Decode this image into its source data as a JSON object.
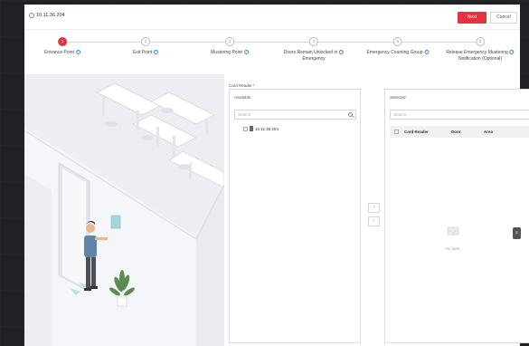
{
  "window": {
    "title": "10.11.36.204",
    "back_glyph": "‹"
  },
  "actions": {
    "next_label": "Next",
    "cancel_label": "Cancel"
  },
  "steps": [
    {
      "num": "1",
      "label": "Entrance Point",
      "active": true
    },
    {
      "num": "2",
      "label": "Exit Point",
      "active": false
    },
    {
      "num": "3",
      "label": "Mustering Point",
      "active": false
    },
    {
      "num": "4",
      "label": "Doors Remain Unlocked in",
      "label2": "Emergency",
      "active": false
    },
    {
      "num": "5",
      "label": "Emergency Counting Group",
      "active": false
    },
    {
      "num": "6",
      "label": "Release Emergency Mustering",
      "label2": "Notification (Optional)",
      "active": false
    }
  ],
  "step_info_glyph": "i",
  "card_reader": {
    "label": "Card Reader *",
    "available": {
      "title": "Available",
      "search_placeholder": "Search",
      "tree": [
        {
          "label": "10.11.36.204"
        }
      ]
    },
    "selected": {
      "title": "Selected",
      "search_placeholder": "Search",
      "columns": [
        "Card Reader",
        "Door",
        "Area"
      ],
      "empty_text": "No data."
    },
    "move_right": "›",
    "move_left": "‹"
  },
  "side_tab_glyph": "≡",
  "colors": {
    "accent": "#e7313b",
    "info": "#3a8ce6"
  },
  "icons": {
    "search": "search-icon",
    "back": "back-icon",
    "device": "device-icon",
    "empty": "empty-box-icon"
  }
}
